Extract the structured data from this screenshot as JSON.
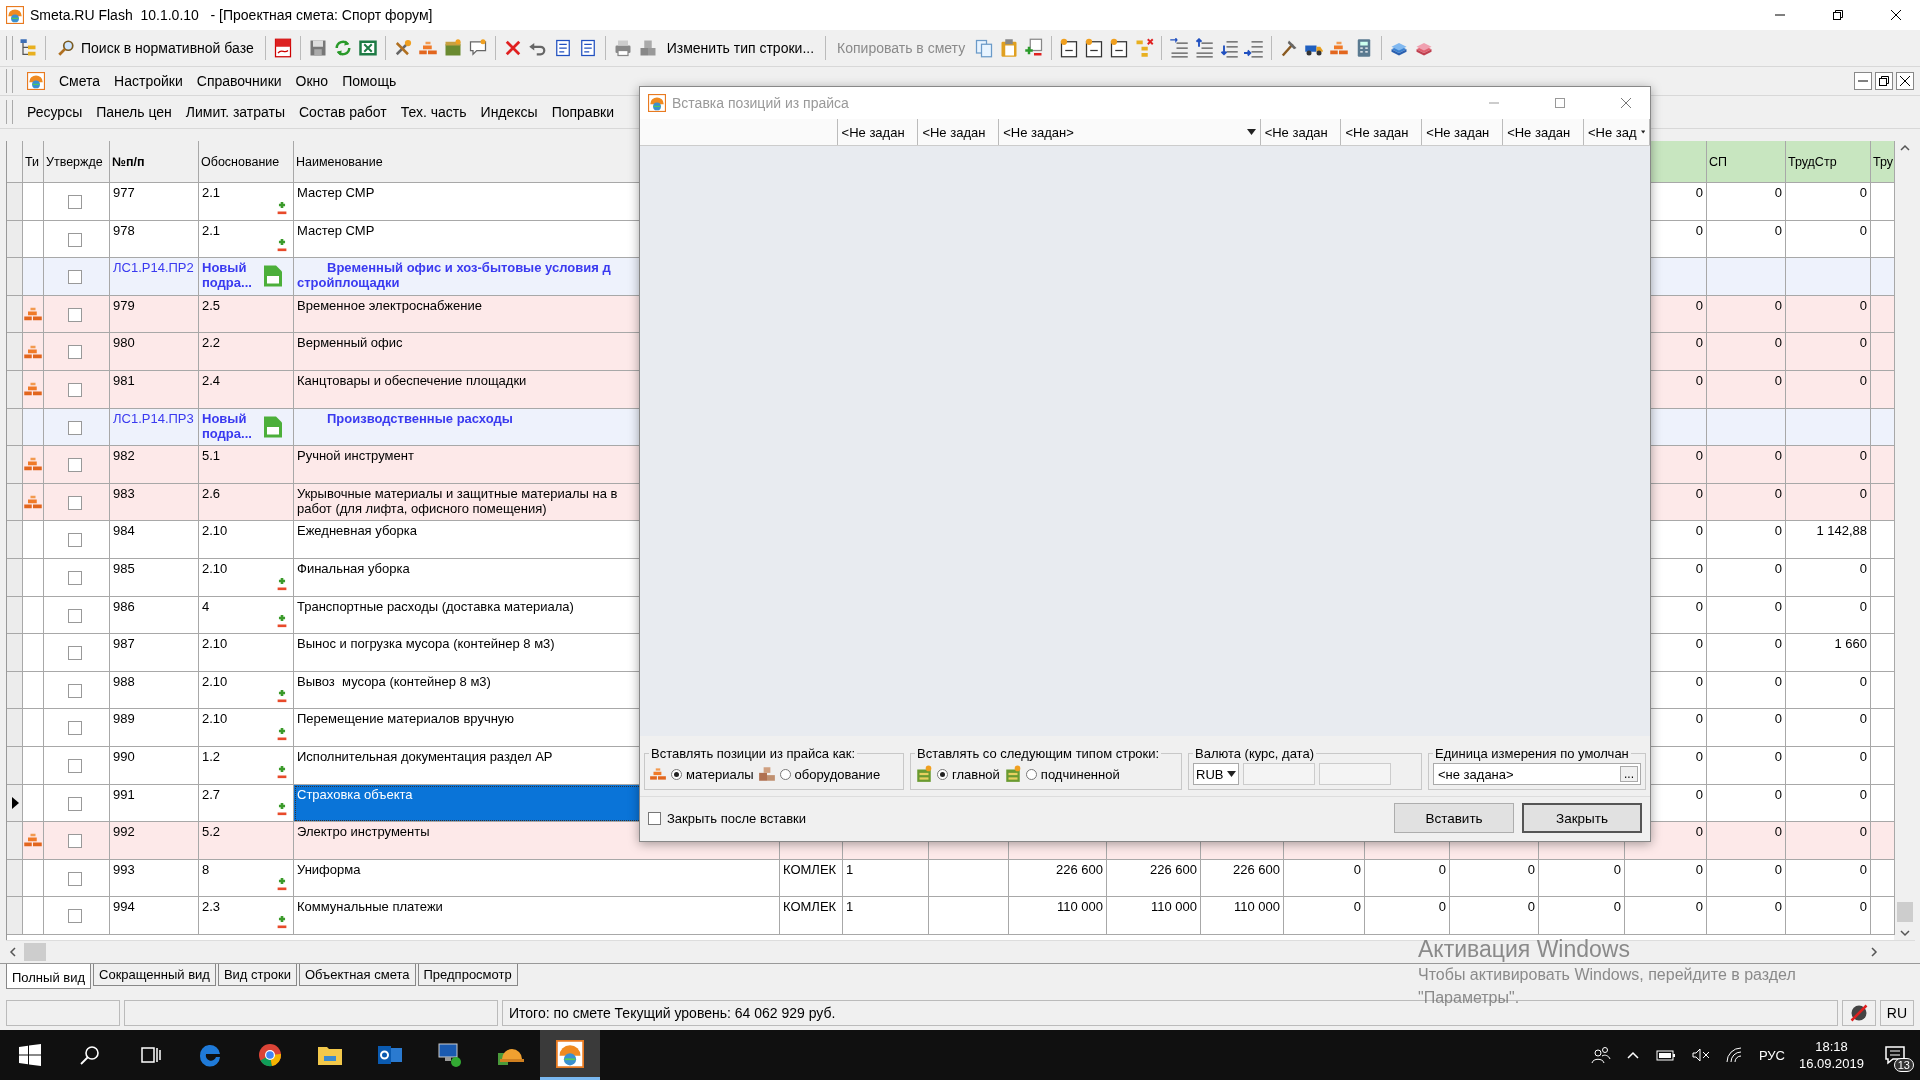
{
  "window": {
    "title": "Smeta.RU Flash  10.1.0.10   - [Проектная смета: Спорт форум]"
  },
  "toolbar": {
    "buttons": [
      {
        "label": "Поиск в нормативной базе",
        "disabled": false
      },
      {
        "label": "Изменить тип строки...",
        "disabled": false
      },
      {
        "label": "Копировать в смету",
        "disabled": true
      }
    ]
  },
  "menu": [
    "Смета",
    "Настройки",
    "Справочники",
    "Окно",
    "Помощь"
  ],
  "panels": [
    "Ресурсы",
    "Панель цен",
    "Лимит. затраты",
    "Состав работ",
    "Тех. часть",
    "Индексы",
    "Поправки"
  ],
  "table": {
    "columns_left": [
      "Ти",
      "Утвержде",
      "№п/п",
      "Обоснование",
      "Наименование"
    ],
    "columns_right": [
      "СП",
      "ТрудСтр",
      "Тру"
    ],
    "rows": [
      {
        "kind": "item",
        "number": "977",
        "basis": "2.1",
        "name": "Мастер СМР",
        "sign_icon": true,
        "approved": false,
        "selected": false,
        "cells": [
          "0",
          "0",
          "0"
        ]
      },
      {
        "kind": "item",
        "number": "978",
        "basis": "2.1",
        "name": "Мастер СМР",
        "sign_icon": true,
        "approved": false,
        "selected": false,
        "cells": [
          "0",
          "0",
          "0"
        ]
      },
      {
        "kind": "section",
        "number": "ЛС1.Р14.ПР2",
        "basis": "Новый подра...",
        "name_lines": [
          "Временный офис и хоз-бытовые условия д",
          "стройплощадки"
        ],
        "approved": false,
        "selected": false
      },
      {
        "kind": "material",
        "number": "979",
        "basis": "2.5",
        "name": "Временное электроснабжение",
        "sign_icon": false,
        "approved": false,
        "selected": false,
        "cells": [
          "0",
          "0",
          "0"
        ]
      },
      {
        "kind": "material",
        "number": "980",
        "basis": "2.2",
        "name": "Верменный офис",
        "sign_icon": false,
        "approved": false,
        "selected": false,
        "cells": [
          "0",
          "0",
          "0"
        ]
      },
      {
        "kind": "material",
        "number": "981",
        "basis": "2.4",
        "name": "Канцтовары и обеспечение площадки",
        "sign_icon": false,
        "approved": false,
        "selected": false,
        "cells": [
          "0",
          "0",
          "0"
        ]
      },
      {
        "kind": "section",
        "number": "ЛС1.Р14.ПР3",
        "basis": "Новый подра...",
        "name_lines": [
          "Производственные расходы"
        ],
        "approved": false,
        "selected": false
      },
      {
        "kind": "material",
        "number": "982",
        "basis": "5.1",
        "name": "Ручной инструмент",
        "sign_icon": false,
        "approved": false,
        "selected": false,
        "cells": [
          "0",
          "0",
          "0"
        ]
      },
      {
        "kind": "material",
        "number": "983",
        "basis": "2.6",
        "name_lines": [
          "Укрывочные материалы и защитные материалы на в",
          "работ (для лифта, офисного помещения)"
        ],
        "sign_icon": false,
        "approved": false,
        "selected": false,
        "cells": [
          "0",
          "0",
          "0"
        ]
      },
      {
        "kind": "item",
        "number": "984",
        "basis": "2.10",
        "name": "Ежедневная уборка",
        "sign_icon": false,
        "approved": false,
        "selected": false,
        "cells": [
          "0",
          "0",
          "1 142,88"
        ]
      },
      {
        "kind": "item",
        "number": "985",
        "basis": "2.10",
        "name": "Финальная уборка",
        "sign_icon": true,
        "approved": false,
        "selected": false,
        "cells": [
          "0",
          "0",
          "0"
        ]
      },
      {
        "kind": "item",
        "number": "986",
        "basis": "4",
        "name": "Транспортные расходы (доставка материала)",
        "sign_icon": true,
        "approved": false,
        "selected": false,
        "cells": [
          "0",
          "0",
          "0"
        ]
      },
      {
        "kind": "item",
        "number": "987",
        "basis": "2.10",
        "name": "Вынос и погрузка мусора (контейнер 8 м3)",
        "sign_icon": false,
        "approved": false,
        "selected": false,
        "cells": [
          "0",
          "0",
          "1 660"
        ]
      },
      {
        "kind": "item",
        "number": "988",
        "basis": "2.10",
        "name": "Вывоз  мусора (контейнер 8 м3)",
        "sign_icon": true,
        "approved": false,
        "selected": false,
        "cells": [
          "0",
          "0",
          "0"
        ]
      },
      {
        "kind": "item",
        "number": "989",
        "basis": "2.10",
        "name": "Перемещение материалов вручную",
        "sign_icon": true,
        "approved": false,
        "selected": false,
        "cells": [
          "0",
          "0",
          "0"
        ]
      },
      {
        "kind": "item",
        "number": "990",
        "basis": "1.2",
        "name": "Исполнительная документация раздел АР",
        "sign_icon": true,
        "approved": false,
        "selected": false,
        "cells": [
          "0",
          "0",
          "0"
        ]
      },
      {
        "kind": "item",
        "number": "991",
        "basis": "2.7",
        "name": "Страховка объекта",
        "sign_icon": true,
        "approved": false,
        "selected": true,
        "cells": [
          "0",
          "0",
          "0"
        ]
      },
      {
        "kind": "material",
        "number": "992",
        "basis": "5.2",
        "name": "Электро инструменты",
        "sign_icon": false,
        "approved": false,
        "selected": false,
        "cells": [
          "0",
          "0",
          "0"
        ]
      },
      {
        "kind": "item",
        "number": "993",
        "basis": "8",
        "name": "Униформа",
        "sign_icon": true,
        "approved": false,
        "selected": false,
        "cells": [
          "КОМЛЕК",
          "1",
          null,
          "226 600",
          "226 600",
          "226 600",
          "0",
          "0",
          "0",
          "0",
          "0",
          "0",
          "0"
        ]
      },
      {
        "kind": "item",
        "number": "994",
        "basis": "2.3",
        "name": "Коммунальные платежи",
        "sign_icon": true,
        "approved": false,
        "selected": false,
        "cells": [
          "КОМЛЕК",
          "1",
          null,
          "110 000",
          "110 000",
          "110 000",
          "0",
          "0",
          "0",
          "0",
          "0",
          "0",
          "0"
        ]
      }
    ]
  },
  "view_tabs": [
    {
      "label": "Полный вид",
      "selected": true
    },
    {
      "label": "Сокращенный вид",
      "selected": false
    },
    {
      "label": "Вид строки",
      "selected": false
    },
    {
      "label": "Объектная смета",
      "selected": false
    },
    {
      "label": "Предпросмотр",
      "selected": false
    }
  ],
  "status_bar": {
    "total": "Итого: по смете Текущий уровень: 64 062 929 руб.",
    "language": "RU"
  },
  "dialog": {
    "title": "Вставка позиций из прайса",
    "columns": [
      {
        "kind": "field",
        "label": "<Не задан"
      },
      {
        "kind": "field",
        "label": "<Не задан"
      },
      {
        "kind": "dropdown",
        "label": "<Не задан>"
      },
      {
        "kind": "field",
        "label": "<Не задан"
      },
      {
        "kind": "field",
        "label": "<Не задан"
      },
      {
        "kind": "field",
        "label": "<Не задан"
      },
      {
        "kind": "field",
        "label": "<Не задан"
      },
      {
        "kind": "dropdown",
        "label": "<Не зад"
      }
    ],
    "insert_as": {
      "legend": "Вставлять позиции из прайса как:",
      "options": [
        {
          "label": "материалы",
          "selected": true
        },
        {
          "label": "оборудование",
          "selected": false
        }
      ]
    },
    "row_type": {
      "legend": "Вставлять со следующим типом строки:",
      "options": [
        {
          "label": "главной",
          "selected": true
        },
        {
          "label": "подчиненной",
          "selected": false
        }
      ]
    },
    "currency": {
      "legend": "Валюта (курс, дата)",
      "value": "RUB"
    },
    "unit": {
      "legend": "Единица измерения по умолчан",
      "value": "<не задана>",
      "button": "..."
    },
    "close_after": {
      "label": "Закрыть после вставки",
      "checked": false
    },
    "buttons": [
      {
        "label": "Вставить",
        "default": false
      },
      {
        "label": "Закрыть",
        "default": true
      }
    ]
  },
  "os_notice": {
    "title": "Активация Windows",
    "lines": [
      "Чтобы активировать Windows, перейдите в раздел",
      "\"Параметры\"."
    ]
  },
  "taskbar": {
    "apps": [
      {
        "selected": false
      },
      {
        "selected": false
      },
      {
        "selected": false
      },
      {
        "selected": false
      },
      {
        "selected": false
      },
      {
        "selected": false
      },
      {
        "selected": true
      }
    ],
    "language": "РУС",
    "time": "18:18",
    "date": "16.09.2019",
    "notifications": "13"
  }
}
